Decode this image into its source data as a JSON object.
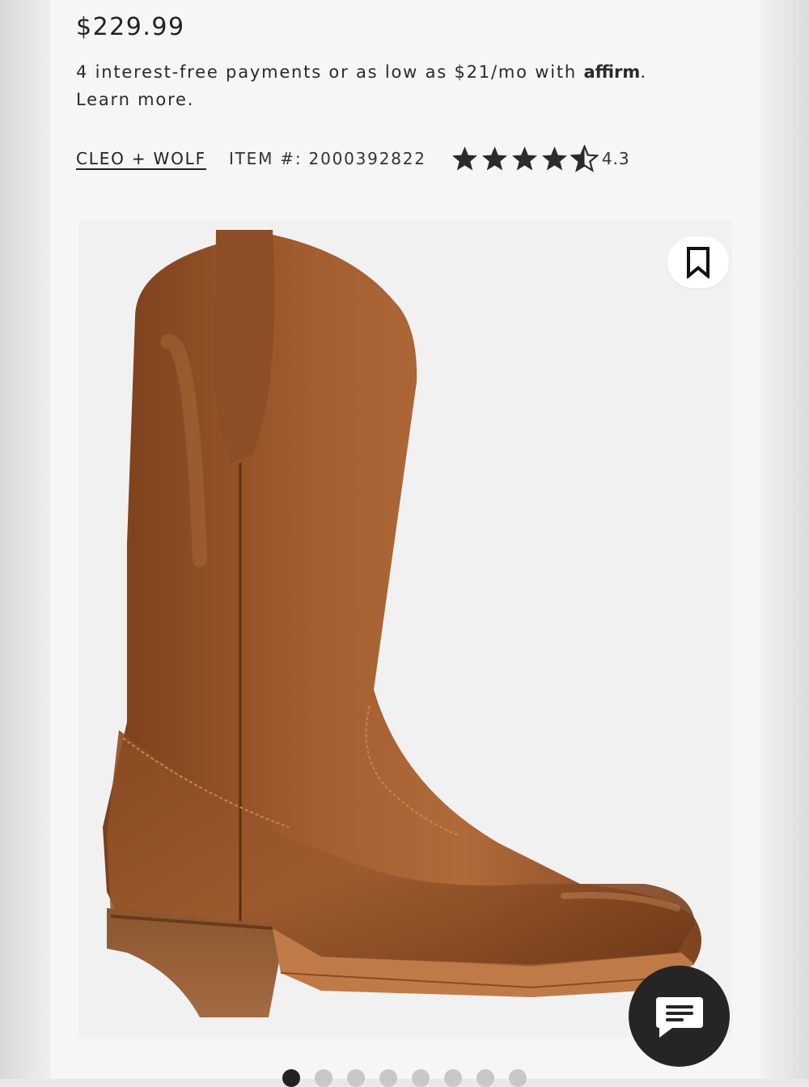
{
  "product": {
    "price": "$229.99",
    "affirm_text": "4 interest-free payments or as low as $21/mo with",
    "affirm_brand": "affirm",
    "affirm_suffix": ".",
    "learn_more": "Learn more.",
    "brand": "CLEO + WOLF",
    "item_number": "ITEM #: 2000392822",
    "rating": 4.3,
    "rating_text": "4.3",
    "stars": [
      {
        "fill": "full"
      },
      {
        "fill": "full"
      },
      {
        "fill": "full"
      },
      {
        "fill": "full"
      },
      {
        "fill": "half"
      }
    ]
  },
  "gallery": {
    "image_alt": "Brown leather western boot",
    "save_icon": "bookmark-icon",
    "slide_count": 8,
    "active_slide": 1
  },
  "chat": {
    "icon": "chat-bubble-icon"
  },
  "colors": {
    "text": "#222222",
    "star": "#2b2b2b",
    "chat_bg": "#252525",
    "dot_active": "#222222",
    "dot_inactive": "#c8c8c8"
  }
}
